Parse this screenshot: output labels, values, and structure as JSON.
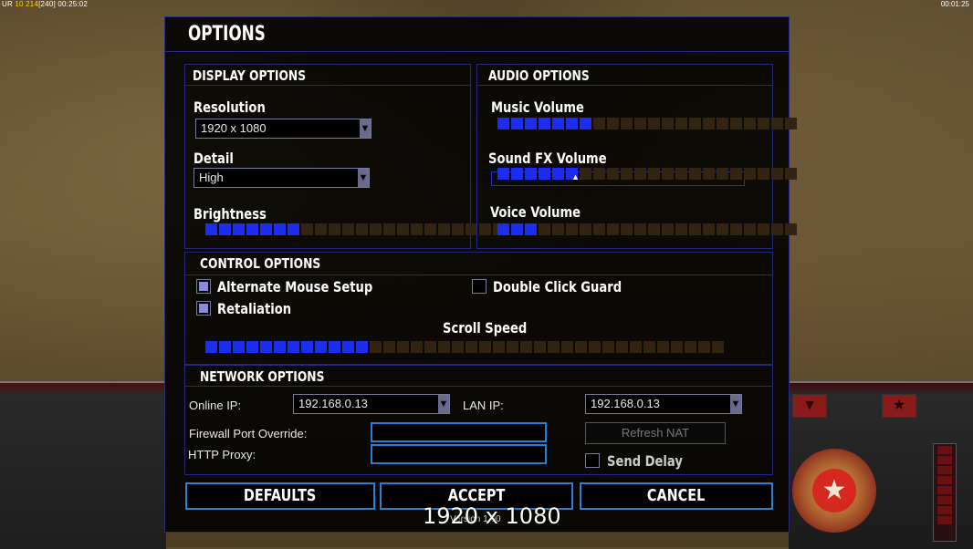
{
  "hud": {
    "left_prefix": "UR",
    "money": "10",
    "power": "214",
    "power_max": "[240]",
    "timer": "00:25:02",
    "clock": "00:01:25"
  },
  "dialog": {
    "title": "OPTIONS",
    "display": {
      "header": "DISPLAY OPTIONS",
      "resolution_label": "Resolution",
      "resolution_value": "1920 x 1080",
      "detail_label": "Detail",
      "detail_value": "High",
      "brightness_label": "Brightness",
      "brightness_level": 0.32,
      "brightness_segments": 22
    },
    "audio": {
      "header": "AUDIO OPTIONS",
      "music_label": "Music Volume",
      "music_level": 0.33,
      "sfx_label": "Sound FX Volume",
      "sfx_level": 0.29,
      "voice_label": "Voice Volume",
      "voice_level": 0.14,
      "segments": 22
    },
    "control": {
      "header": "CONTROL OPTIONS",
      "alt_mouse_label": "Alternate Mouse Setup",
      "alt_mouse_checked": true,
      "retaliation_label": "Retaliation",
      "retaliation_checked": true,
      "double_click_label": "Double Click Guard",
      "double_click_checked": false,
      "scroll_label": "Scroll Speed",
      "scroll_level": 0.31,
      "scroll_segments": 38
    },
    "network": {
      "header": "NETWORK OPTIONS",
      "online_ip_label": "Online IP:",
      "online_ip_value": "192.168.0.13",
      "lan_ip_label": "LAN IP:",
      "lan_ip_value": "192.168.0.13",
      "firewall_label": "Firewall Port Override:",
      "firewall_value": "",
      "proxy_label": "HTTP Proxy:",
      "proxy_value": "",
      "refresh_nat_label": "Refresh NAT",
      "send_delay_label": "Send Delay",
      "send_delay_checked": false
    },
    "buttons": {
      "defaults": "DEFAULTS",
      "accept": "ACCEPT",
      "cancel": "CANCEL"
    },
    "version": "Version 1.00"
  },
  "overlay_resolution": "1920 x 1080",
  "colors": {
    "accent": "#2a7fd0",
    "bar_on": "#1c2cf0",
    "bar_off": "#332411",
    "panel_border": "#28287a"
  }
}
